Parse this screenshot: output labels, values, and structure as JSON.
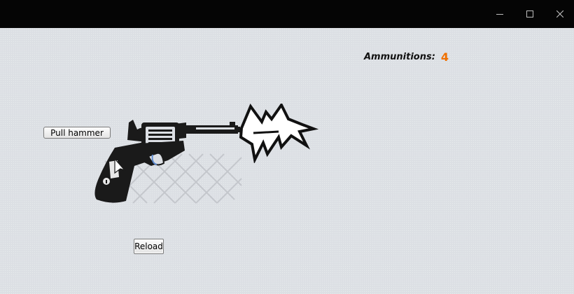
{
  "window": {
    "controls": {
      "minimize_icon": "minimize-icon",
      "maximize_icon": "maximize-icon",
      "close_icon": "close-icon"
    }
  },
  "ammo": {
    "label": "Ammunitions:",
    "count": "4",
    "count_color": "#f07000"
  },
  "buttons": {
    "pull_hammer": "Pull hammer",
    "reload": "Reload"
  },
  "graphics": {
    "revolver_icon": "revolver-icon",
    "muzzle_flash_icon": "muzzle-flash-icon"
  }
}
